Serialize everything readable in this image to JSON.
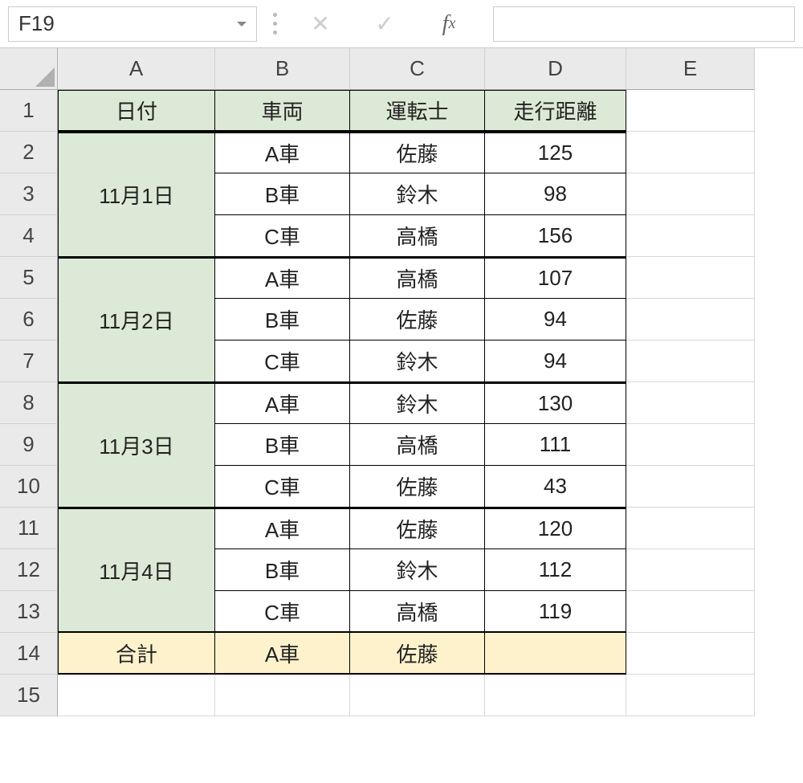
{
  "name_box": "F19",
  "formula_input": "",
  "col_headers": [
    "A",
    "B",
    "C",
    "D",
    "E"
  ],
  "row_headers": [
    "1",
    "2",
    "3",
    "4",
    "5",
    "6",
    "7",
    "8",
    "9",
    "10",
    "11",
    "12",
    "13",
    "14",
    "15"
  ],
  "headers": {
    "date": "日付",
    "vehicle": "車両",
    "driver": "運転士",
    "distance": "走行距離"
  },
  "groups": [
    {
      "date": "11月1日",
      "rows": [
        {
          "vehicle": "A車",
          "driver": "佐藤",
          "distance": "125"
        },
        {
          "vehicle": "B車",
          "driver": "鈴木",
          "distance": "98"
        },
        {
          "vehicle": "C車",
          "driver": "高橋",
          "distance": "156"
        }
      ]
    },
    {
      "date": "11月2日",
      "rows": [
        {
          "vehicle": "A車",
          "driver": "高橋",
          "distance": "107"
        },
        {
          "vehicle": "B車",
          "driver": "佐藤",
          "distance": "94"
        },
        {
          "vehicle": "C車",
          "driver": "鈴木",
          "distance": "94"
        }
      ]
    },
    {
      "date": "11月3日",
      "rows": [
        {
          "vehicle": "A車",
          "driver": "鈴木",
          "distance": "130"
        },
        {
          "vehicle": "B車",
          "driver": "高橋",
          "distance": "111"
        },
        {
          "vehicle": "C車",
          "driver": "佐藤",
          "distance": "43"
        }
      ]
    },
    {
      "date": "11月4日",
      "rows": [
        {
          "vehicle": "A車",
          "driver": "佐藤",
          "distance": "120"
        },
        {
          "vehicle": "B車",
          "driver": "鈴木",
          "distance": "112"
        },
        {
          "vehicle": "C車",
          "driver": "高橋",
          "distance": "119"
        }
      ]
    }
  ],
  "total": {
    "label": "合計",
    "vehicle": "A車",
    "driver": "佐藤",
    "distance": ""
  }
}
